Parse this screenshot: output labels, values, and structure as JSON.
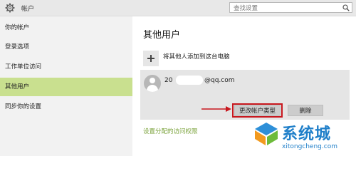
{
  "titlebar": {
    "app_title": "帐户",
    "search_placeholder": "查找设置"
  },
  "sidebar": {
    "items": [
      {
        "label": "你的帐户",
        "active": false
      },
      {
        "label": "登录选项",
        "active": false
      },
      {
        "label": "工作单位访问",
        "active": false
      },
      {
        "label": "其他用户",
        "active": true
      },
      {
        "label": "同步你的设置",
        "active": false
      }
    ]
  },
  "main": {
    "heading": "其他用户",
    "add_user_label": "将其他人添加到这台电脑",
    "account": {
      "email_prefix": "20",
      "email_suffix": "@qq.com"
    },
    "buttons": {
      "change_type": "更改帐户类型",
      "delete": "删除"
    },
    "access_link": "设置分配的访问权限"
  },
  "watermark": {
    "brand_cn": "系统城",
    "site": "xitongcheng.com"
  },
  "colors": {
    "accent": "#c9e08f",
    "link": "#7aa23a",
    "highlight": "#c8171e",
    "watermark": "#1f7fc9"
  }
}
